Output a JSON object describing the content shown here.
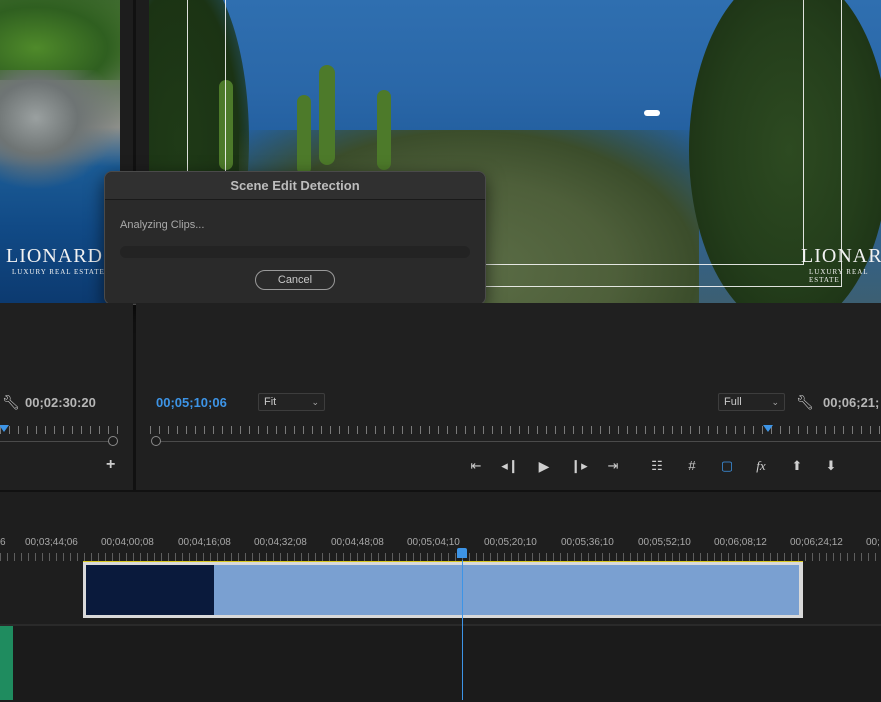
{
  "source_monitor": {
    "timecode": "00;02:30:20",
    "logo_main": "LIONARD",
    "logo_sub": "LUXURY REAL ESTATE"
  },
  "program_monitor": {
    "timecode": "00;05;10;06",
    "fit_select": "Fit",
    "full_select": "Full",
    "end_timecode": "00;06;21;",
    "logo_main": "LIONARD",
    "logo_sub": "LUXURY REAL ESTATE"
  },
  "dialog": {
    "title": "Scene Edit Detection",
    "status": "Analyzing Clips...",
    "progress_fraction": 0.0,
    "cancel_label": "Cancel"
  },
  "controls": {
    "add_icon": "+",
    "icons": [
      "go-to-in-icon",
      "step-back-icon",
      "play-icon",
      "step-forward-icon",
      "go-to-out-icon",
      "trim-icon",
      "grid-icon",
      "safe-margins-icon",
      "fx-icon",
      "lift-icon",
      "extract-icon"
    ]
  },
  "timeline": {
    "ruler_labels": [
      "6",
      "00;03;44;06",
      "00;04;00;08",
      "00;04;16;08",
      "00;04;32;08",
      "00;04;48;08",
      "00;05;04;10",
      "00;05;20;10",
      "00;05;36;10",
      "00;05;52;10",
      "00;06;08;12",
      "00;06;24;12",
      "00;"
    ]
  },
  "colors": {
    "accent": "#3d94e6",
    "clip": "#7aa0d1",
    "audio_clip": "#1f8c5f",
    "marker_line": "#d8c81e"
  }
}
